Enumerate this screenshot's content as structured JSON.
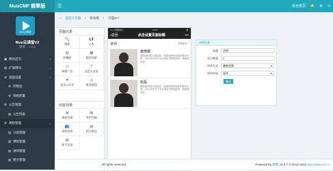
{
  "topbar": {
    "brand": "MuuCMF 微擎版",
    "right": [
      "后台首页",
      "消息",
      "设置",
      "退出"
    ]
  },
  "sidebar": {
    "logo_caption": "Muu云课堂",
    "app_name": "Muu云课堂V2",
    "version": "版本：1.2.2",
    "items": [
      {
        "label": "模块首页",
        "icon": "▣",
        "arrow": "‹",
        "sub": false,
        "active": false
      },
      {
        "label": "扩展模块",
        "icon": "▤",
        "arrow": "‹",
        "sub": false,
        "active": false
      },
      {
        "label": "基础设置",
        "icon": "⚙",
        "arrow": "‹",
        "sub": false,
        "active": false
      },
      {
        "label": "控制台",
        "icon": "⚙",
        "arrow": "",
        "sub": true,
        "active": false
      },
      {
        "label": "系统配置",
        "icon": "⚙",
        "arrow": "",
        "sub": true,
        "active": false
      },
      {
        "label": "公告管理",
        "icon": "⚙",
        "arrow": "‹",
        "sub": false,
        "active": false
      },
      {
        "label": "公告列表",
        "icon": "▤",
        "arrow": "",
        "sub": true,
        "active": false
      },
      {
        "label": "课程管理",
        "icon": "⚙",
        "arrow": "‹",
        "sub": false,
        "active": true
      },
      {
        "label": "分类管理",
        "icon": "▤",
        "arrow": "",
        "sub": true,
        "active": false
      },
      {
        "label": "课程管理",
        "icon": "▤",
        "arrow": "",
        "sub": true,
        "active": false
      },
      {
        "label": "讲师管理",
        "icon": "▤",
        "arrow": "",
        "sub": true,
        "active": false
      },
      {
        "label": "图文管理",
        "icon": "▤",
        "arrow": "",
        "sub": true,
        "active": false
      }
    ]
  },
  "breadcrumb": {
    "home": "自定义页面",
    "sep": "/",
    "mid": "移动端",
    "current": "页面DIY"
  },
  "elements_panel": {
    "title": "页面元素",
    "items": [
      {
        "label": "搜索",
        "icon": "🔍"
      },
      {
        "label": "公告",
        "icon": "📢"
      },
      {
        "label": "轮播图",
        "icon": "▧"
      },
      {
        "label": "图文导航",
        "icon": "▦"
      },
      {
        "label": "单图广告",
        "icon": "▭"
      },
      {
        "label": "自定义文本",
        "icon": "T"
      },
      {
        "label": "关注公众号",
        "icon": "♥"
      },
      {
        "label": "悬浮按钮",
        "icon": "◎"
      }
    ],
    "content_title": "内容列表",
    "content_items": [
      {
        "label": "课程列表",
        "icon": "▤"
      },
      {
        "label": "专栏列表",
        "icon": "▤"
      },
      {
        "label": "讲师列表",
        "icon": "👥"
      },
      {
        "label": "积分商品",
        "icon": "▤"
      },
      {
        "label": "线下活动",
        "icon": "▤"
      }
    ]
  },
  "phone": {
    "status_left": "••••• 中国移动 ⁺",
    "status_time": "12:00",
    "status_right": "🔋",
    "back": "‹返回",
    "title": "点击设置页面标题",
    "menu": "•••",
    "section_title": "讲师",
    "more": "查看更多 ›",
    "teachers": [
      {
        "name": "姜丽娜",
        "desc": "要拍她的照片很容易，但要拍得有味道好看却不易。2002年毕业于北京电影学院摄影系，我都是好好。"
      },
      {
        "name": "赵磊",
        "desc": "要拍她的照片很容易，但要拍得有味道好看却不易。2002年毕业于北京电影学院摄影系，我都是好好。"
      }
    ],
    "save": "保存"
  },
  "props": {
    "title": "讲师列表",
    "rows": [
      {
        "label": "标题",
        "value": "讲师",
        "select": false
      },
      {
        "label": "显示数量",
        "value": "2",
        "select": false
      },
      {
        "label": "排序方式",
        "value": "最新创建",
        "select": true
      },
      {
        "label": "排列布局",
        "value": "竖排",
        "select": true
      }
    ],
    "button": "确认"
  },
  "footer": {
    "left": "All rights reserved.",
    "right_prefix": "Powered by ",
    "right_brand": "微擎",
    "right_suffix": " v2.5.7 © 2014-2015 ",
    "right_link": "http://www.w7.cc"
  }
}
